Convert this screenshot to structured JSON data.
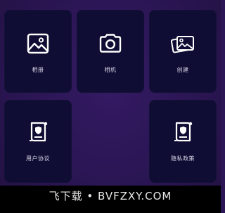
{
  "menu": {
    "items": [
      {
        "label": "相册",
        "icon": "image-icon"
      },
      {
        "label": "相机",
        "icon": "camera-icon"
      },
      {
        "label": "创建",
        "icon": "images-stack-icon"
      },
      {
        "label": "用户协议",
        "icon": "document-shield-icon"
      },
      {
        "label": "隐私政策",
        "icon": "document-shield-icon"
      }
    ]
  },
  "watermark": {
    "text": "飞下载 • BVFZXY.COM"
  },
  "colors": {
    "background": "#2c1655",
    "tile": "#0f0d33",
    "text": "#d8d6e8",
    "footer": "#000000"
  }
}
